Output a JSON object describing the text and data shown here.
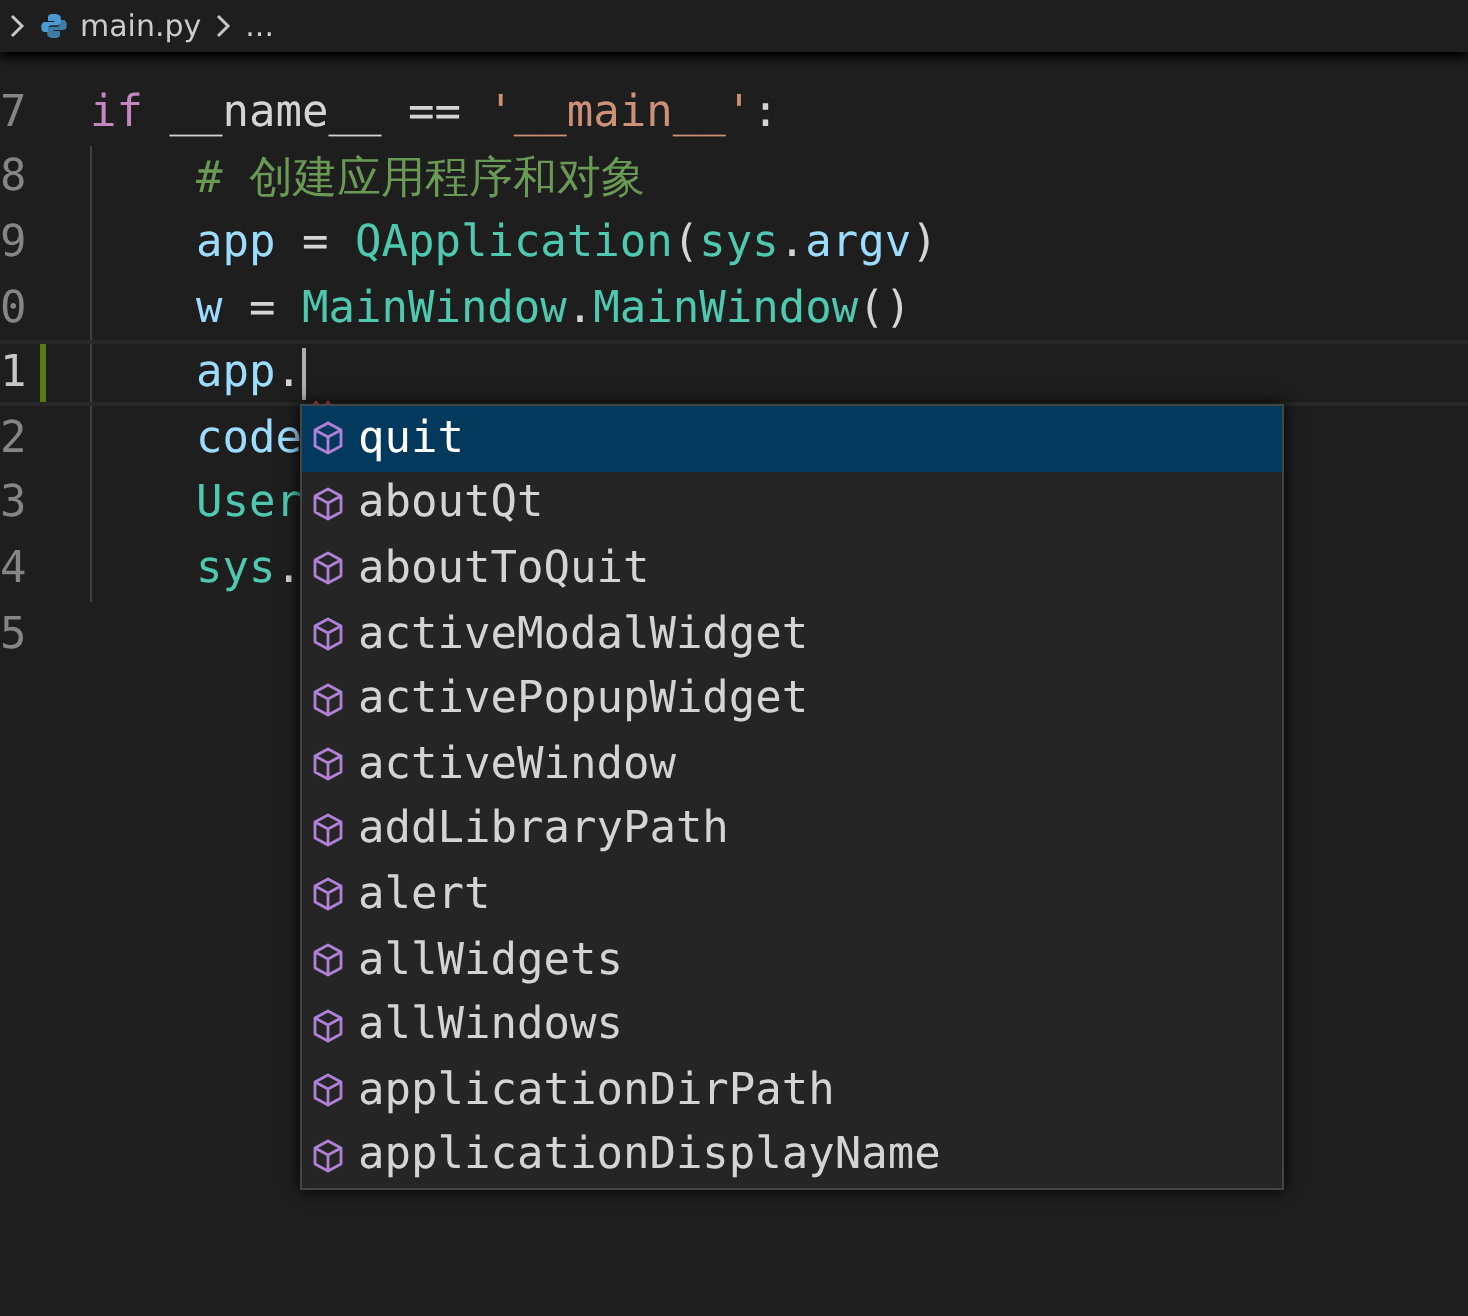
{
  "breadcrumb": {
    "items": [
      "main.py",
      "..."
    ]
  },
  "editor": {
    "lines": [
      {
        "number": "7",
        "tokens": [
          {
            "text": "if",
            "kind": "keyword"
          },
          {
            "text": " __name__ == ",
            "kind": "plain"
          },
          {
            "text": "'__main__'",
            "kind": "string"
          },
          {
            "text": ":",
            "kind": "plain"
          }
        ],
        "children": [
          {
            "number": "8",
            "tokens": [
              {
                "text": "# 创建应用程序和对象",
                "kind": "comment"
              }
            ]
          },
          {
            "number": "9",
            "tokens": [
              {
                "text": "app",
                "kind": "variable"
              },
              {
                "text": " = ",
                "kind": "plain"
              },
              {
                "text": "QApplication",
                "kind": "class"
              },
              {
                "text": "(",
                "kind": "plain"
              },
              {
                "text": "sys",
                "kind": "class"
              },
              {
                "text": ".",
                "kind": "plain"
              },
              {
                "text": "argv",
                "kind": "variable"
              },
              {
                "text": ")",
                "kind": "plain"
              }
            ]
          },
          {
            "number": "0",
            "tokens": [
              {
                "text": "w",
                "kind": "variable"
              },
              {
                "text": " = ",
                "kind": "plain"
              },
              {
                "text": "MainWindow",
                "kind": "class"
              },
              {
                "text": ".",
                "kind": "plain"
              },
              {
                "text": "MainWindow",
                "kind": "class"
              },
              {
                "text": "()",
                "kind": "plain"
              }
            ]
          },
          {
            "number": "1",
            "current": true,
            "modified": true,
            "cursor": true,
            "squiggle": true,
            "tokens": [
              {
                "text": "app",
                "kind": "variable"
              },
              {
                "text": ".",
                "kind": "plain"
              }
            ]
          },
          {
            "number": "2",
            "tokens": [
              {
                "text": "code",
                "kind": "variable"
              }
            ]
          },
          {
            "number": "3",
            "tokens": [
              {
                "text": "User",
                "kind": "class"
              }
            ]
          },
          {
            "number": "4",
            "tokens": [
              {
                "text": "sys",
                "kind": "class"
              },
              {
                "text": ".",
                "kind": "plain"
              }
            ]
          }
        ]
      },
      {
        "number": "5"
      }
    ]
  },
  "suggestions": [
    {
      "label": "quit",
      "selected": true
    },
    {
      "label": "aboutQt",
      "selected": false
    },
    {
      "label": "aboutToQuit",
      "selected": false
    },
    {
      "label": "activeModalWidget",
      "selected": false
    },
    {
      "label": "activePopupWidget",
      "selected": false
    },
    {
      "label": "activeWindow",
      "selected": false
    },
    {
      "label": "addLibraryPath",
      "selected": false
    },
    {
      "label": "alert",
      "selected": false
    },
    {
      "label": "allWidgets",
      "selected": false
    },
    {
      "label": "allWindows",
      "selected": false
    },
    {
      "label": "applicationDirPath",
      "selected": false
    },
    {
      "label": "applicationDisplayName",
      "selected": false
    }
  ]
}
